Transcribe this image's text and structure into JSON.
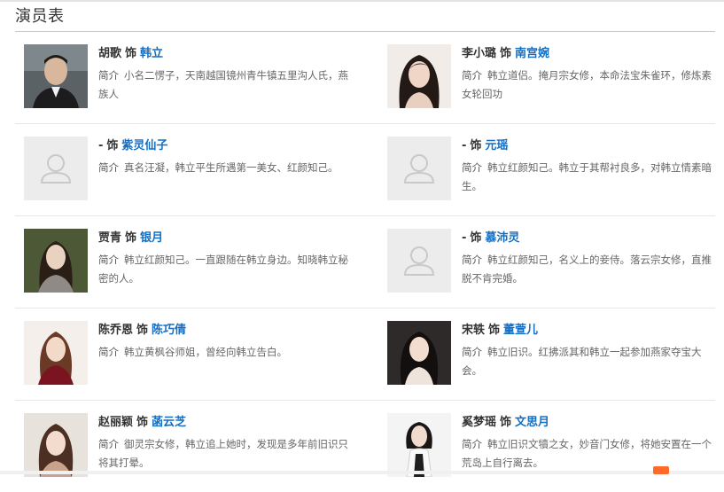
{
  "section": {
    "title": "演员表"
  },
  "desc_label": "简介",
  "role_word": "饰",
  "cast": [
    {
      "actor": "胡歌",
      "role": "韩立",
      "desc": "小名二愣子，天南越国镜州青牛镇五里沟人氏，燕族人",
      "photo": "actor-photo-hu-ge"
    },
    {
      "actor": "李小璐",
      "role": "南宫婉",
      "desc": "韩立道侣。掩月宗女修，本命法宝朱雀环，修炼素女轮回功",
      "photo": "actor-photo-li-xiaolu"
    },
    {
      "actor": "-",
      "role": "紫灵仙子",
      "desc": "真名汪凝，韩立平生所遇第一美女、红颜知己。",
      "photo": "placeholder-avatar"
    },
    {
      "actor": "-",
      "role": "元瑶",
      "desc": "韩立红颜知己。韩立于其帮衬良多，对韩立情素暗生。",
      "photo": "placeholder-avatar"
    },
    {
      "actor": "贾青",
      "role": "银月",
      "desc": "韩立红颜知己。一直跟随在韩立身边。知晓韩立秘密的人。",
      "photo": "actor-photo-jia-qing"
    },
    {
      "actor": "-",
      "role": "慕沛灵",
      "desc": "韩立红颜知己，名义上的妾侍。落云宗女修，直推脱不肯完婚。",
      "photo": "placeholder-avatar"
    },
    {
      "actor": "陈乔恩",
      "role": "陈巧倩",
      "desc": "韩立黄枫谷师姐，曾经向韩立告白。",
      "photo": "actor-photo-chen-qiaoen"
    },
    {
      "actor": "宋轶",
      "role": "董萱儿",
      "desc": "韩立旧识。红拂派其和韩立一起参加燕家夺宝大会。",
      "photo": "actor-photo-song-yi"
    },
    {
      "actor": "赵丽颖",
      "role": "菡云芝",
      "desc": "御灵宗女修，韩立追上她时，发现是多年前旧识只将其打晕。",
      "photo": "actor-photo-zhao-liying"
    },
    {
      "actor": "奚梦瑶",
      "role": "文思月",
      "desc": "韩立旧识文犢之女，妙音门女修，将她安置在一个荒岛上自行离去。",
      "photo": "actor-photo-xi-mengyao"
    }
  ],
  "colors": {
    "role_link": "#136ec2",
    "text": "#333333",
    "muted": "#666666",
    "divider": "#e6e6e6"
  }
}
